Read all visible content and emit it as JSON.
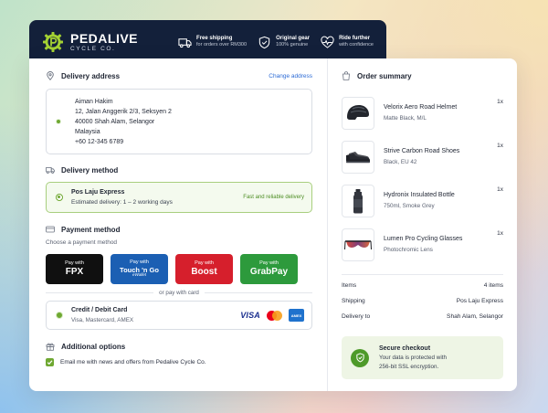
{
  "brand": {
    "name": "PEDALIVE",
    "tagline": "CYCLE CO."
  },
  "perks": [
    {
      "icon": "truck-icon",
      "title": "Free shipping",
      "subtitle": "for orders over RM300"
    },
    {
      "icon": "shield-check-icon",
      "title": "Original gear",
      "subtitle": "100% genuine"
    },
    {
      "icon": "heart-pulse-icon",
      "title": "Ride further",
      "subtitle": "with confidence"
    }
  ],
  "delivery_address": {
    "heading": "Delivery address",
    "change_label": "Change address",
    "lines": [
      "Aiman Hakim",
      "12, Jalan Anggerik 2/3, Seksyen 2",
      "40000 Shah Alam, Selangor",
      "Malaysia",
      "+60 12-345 6789"
    ]
  },
  "delivery_method": {
    "heading": "Delivery method",
    "title": "Pos Laju Express",
    "subtitle": "Estimated delivery: 1 – 2 working days",
    "tag": "Fast and reliable delivery"
  },
  "payment": {
    "heading": "Payment method",
    "subheading": "Choose a payment method",
    "options": [
      {
        "with": "Pay with",
        "name": "FPX",
        "mini": ""
      },
      {
        "with": "Pay with",
        "name": "Touch 'n Go",
        "mini": "eWallet"
      },
      {
        "with": "Pay with",
        "name": "Boost",
        "mini": ""
      },
      {
        "with": "Pay with",
        "name": "GrabPay",
        "mini": ""
      }
    ],
    "or_label": "or pay with card",
    "card": {
      "title": "Credit / Debit Card",
      "subtitle": "Visa, Mastercard, AMEX",
      "visa": "VISA",
      "amex": "AMEX"
    }
  },
  "additional": {
    "heading": "Additional options",
    "newsletter_label": "Email me with news and offers from Pedalive Cycle Co.",
    "newsletter_checked": true
  },
  "order_summary": {
    "heading": "Order summary",
    "items": [
      {
        "name": "Velorix Aero Road Helmet",
        "variant": "Matte Black, M/L",
        "qty": "1x",
        "icon": "helmet-icon"
      },
      {
        "name": "Strive Carbon Road Shoes",
        "variant": "Black, EU 42",
        "qty": "1x",
        "icon": "shoe-icon"
      },
      {
        "name": "Hydronix Insulated Bottle",
        "variant": "750ml, Smoke Grey",
        "qty": "1x",
        "icon": "bottle-icon"
      },
      {
        "name": "Lumen Pro Cycling Glasses",
        "variant": "Photochromic Lens",
        "qty": "1x",
        "icon": "glasses-icon"
      }
    ],
    "rows": [
      {
        "label": "Items",
        "value": "4 items"
      },
      {
        "label": "Shipping",
        "value": "Pos Laju Express"
      },
      {
        "label": "Delivery to",
        "value": "Shah Alam, Selangor"
      }
    ],
    "secure": {
      "title": "Secure checkout",
      "line1": "Your data is protected with",
      "line2": "256-bit SSL encryption."
    }
  }
}
